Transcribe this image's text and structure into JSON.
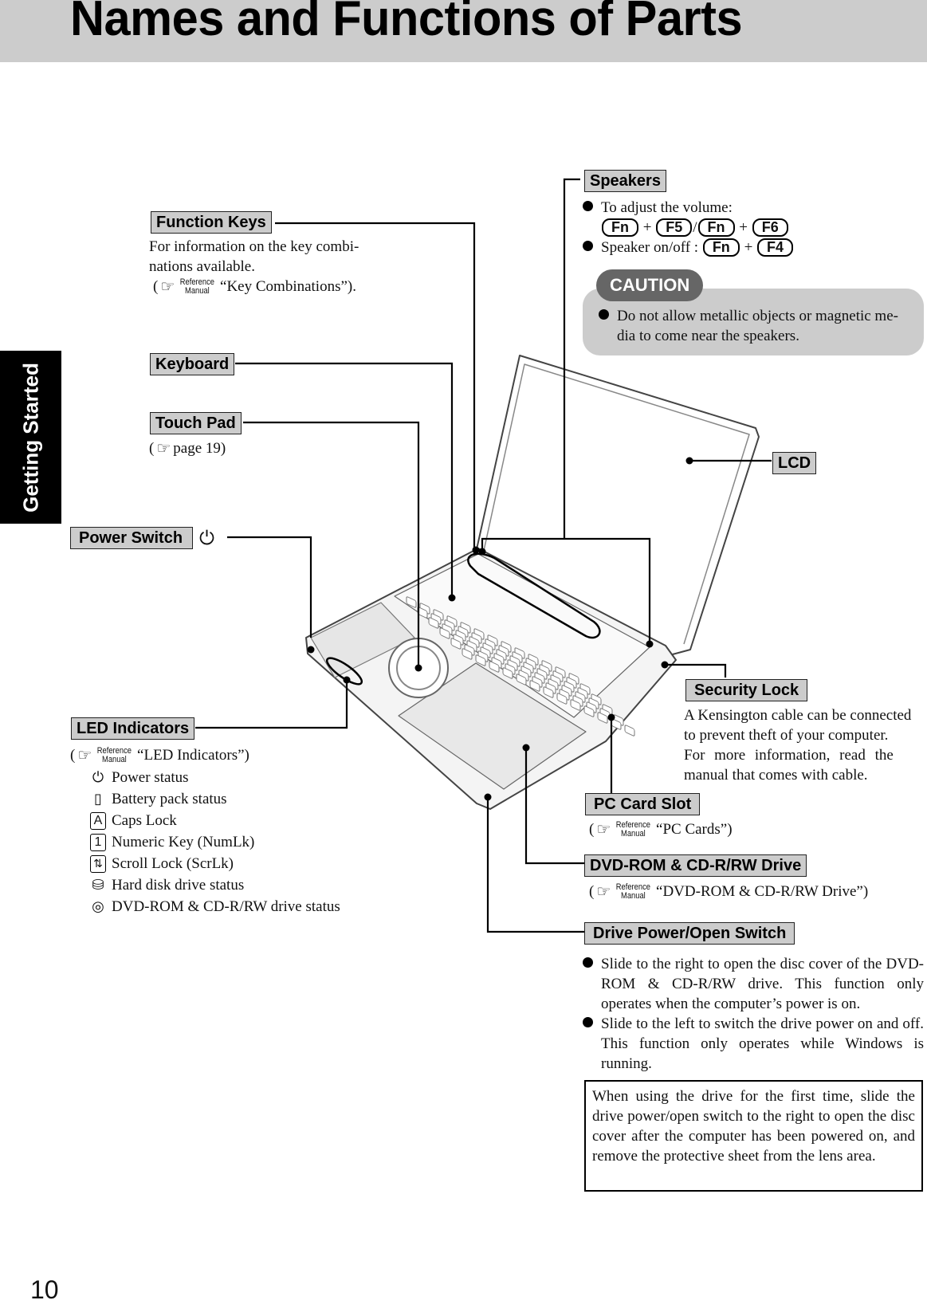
{
  "header": {
    "title": "Names and Functions of Parts"
  },
  "side_tab": {
    "label": "Getting Started"
  },
  "page_number": "10",
  "reference_manual": {
    "line1": "Reference",
    "line2": "Manual"
  },
  "parts": {
    "function_keys": {
      "label": "Function Keys",
      "desc_line1": "For information on the key combi-",
      "desc_line2": "nations available.",
      "ref_text": "“Key Combinations”)."
    },
    "keyboard": {
      "label": "Keyboard"
    },
    "touch_pad": {
      "label": "Touch Pad",
      "ref_text": "page 19)"
    },
    "power_switch": {
      "label": "Power Switch",
      "icon": "power-icon"
    },
    "led_indicators": {
      "label": "LED Indicators",
      "ref_text": "“LED Indicators”)",
      "items": [
        {
          "icon": "power-status-icon",
          "glyph": "⏻",
          "text": "Power status"
        },
        {
          "icon": "battery-icon",
          "glyph": "▯",
          "text": "Battery pack status"
        },
        {
          "icon": "caps-lock-icon",
          "glyph": "A",
          "text": "Caps Lock"
        },
        {
          "icon": "num-lock-icon",
          "glyph": "1",
          "text": "Numeric Key (NumLk)"
        },
        {
          "icon": "scroll-lock-icon",
          "glyph": "⇅",
          "text": "Scroll Lock (ScrLk)"
        },
        {
          "icon": "hard-disk-icon",
          "glyph": "⛁",
          "text": "Hard disk drive status"
        },
        {
          "icon": "dvd-drive-icon",
          "glyph": "◎",
          "text": "DVD-ROM & CD-R/RW drive status"
        }
      ]
    },
    "speakers": {
      "label": "Speakers",
      "bullet1": "To adjust the volume:",
      "keys_volume": [
        "Fn",
        "F5",
        "Fn",
        "F6"
      ],
      "bullet2": "Speaker on/off :",
      "keys_onoff": [
        "Fn",
        "F4"
      ],
      "plus": "+",
      "slash": "/"
    },
    "caution": {
      "label": "CAUTION",
      "line1": "Do not allow metallic objects or magnetic me-",
      "line2": "dia to come near the speakers."
    },
    "lcd": {
      "label": "LCD"
    },
    "security_lock": {
      "label": "Security Lock",
      "desc": "A Kensington cable can be connected to prevent theft of your computer. For more information, read the manual that comes with cable.",
      "lines": [
        "A Kensington cable can be connected",
        "to prevent theft of your computer.",
        "For more information, read the",
        "manual that comes with cable."
      ]
    },
    "pc_card_slot": {
      "label": "PC Card Slot",
      "ref_text": "“PC Cards”)"
    },
    "dvd_drive": {
      "label": "DVD-ROM & CD-R/RW Drive",
      "ref_text": "“DVD-ROM & CD-R/RW Drive”)"
    },
    "drive_switch": {
      "label": "Drive Power/Open Switch",
      "bullet1": "Slide to the right to open the disc cover of the DVD-ROM & CD-R/RW drive. This function only operates when the computer’s power is on.",
      "bullet2": "Slide to the left to switch the drive power on and off. This function only operates while Windows is running.",
      "note": "When using the drive for the first time, slide the drive power/open switch to the right to open the disc cover after the computer has been powered on, and remove the protective sheet from the lens area."
    }
  }
}
